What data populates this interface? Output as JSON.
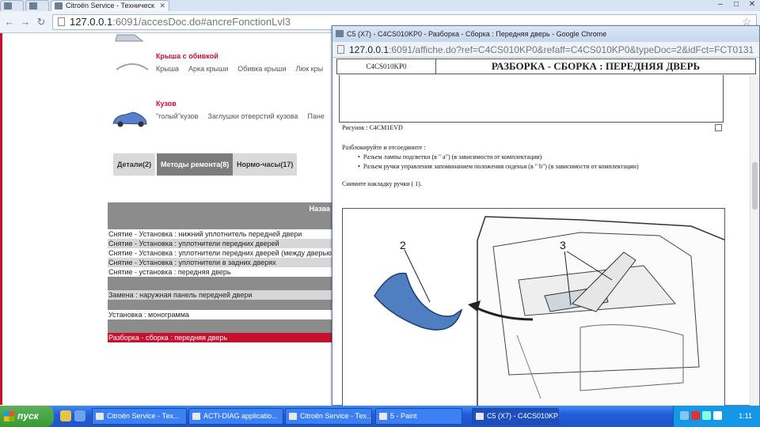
{
  "main_window": {
    "tab_title": "Citroën Service - Техническ",
    "url_host": "127.0.0.1",
    "url_rest": ":6091/accesDoc.do#ancreFonctionLvl3"
  },
  "categories": [
    {
      "title": "Крыша с обивкой",
      "links": [
        "Крыша",
        "Арка крыши",
        "Обивка крыши",
        "Люк кры"
      ]
    },
    {
      "title": "Кузов",
      "links": [
        "\"голый\"кузов",
        "Заглушки отверстий кузова",
        "Пане"
      ]
    }
  ],
  "tabs": [
    "Детали(2)",
    "Методы ремонта(8)",
    "Нормо-часы(17)"
  ],
  "table": {
    "header": "Назва",
    "rows": [
      "Снятие - Установка : нижний уплотнитель передней двери",
      "Снятие - Установка : уплотнители передних дверей",
      "Снятие - Установка : уплотнители передних дверей (между дверью",
      "Снятие - Установка : уплотнители в задних дверях",
      "Снятие - установка : передняя дверь",
      "Замена : наружная панель передней двери",
      "Установка : монограмма",
      "Разборка - сборка : передняя дверь"
    ]
  },
  "popup": {
    "title": "C5 (X7) - C4CS010KP0 - Разборка - Сборка : Передняя дверь - Google Chrome",
    "url_host": "127.0.0.1",
    "url_rest": ":6091/affiche.do?ref=C4CS010KP0&refaff=C4CS010KP0&typeDoc=2&idFct=FCT0131",
    "doc_code": "C4CS010KP0",
    "doc_title": "РАЗБОРКА - СБОРКА : ПЕРЕДНЯЯ ДВЕРЬ",
    "figure_label": "Рисунок : C4CM1EVD",
    "instruction": "Разблокируйте и отсоедините :",
    "bullets": [
      "Разъем лампы подсветки  (в \" a\")  (в зависимости от комплектации)",
      "Разъем ручки управления запоминанием положения сиденья  (в \" b\")  (в зависимости от комплектации)"
    ],
    "step2": "Снимите накладку ручки ( 1).",
    "callouts": [
      "2",
      "3"
    ]
  },
  "taskbar": {
    "start": "пуск",
    "items": [
      "Citroën Service - Тех...",
      "ACTI-DIAG applicatio...",
      "Citroën Service - Тех...",
      "5 - Paint",
      "C5 (X7) - C4CS010KP..."
    ],
    "lang": "EN",
    "clock": "1:11"
  }
}
